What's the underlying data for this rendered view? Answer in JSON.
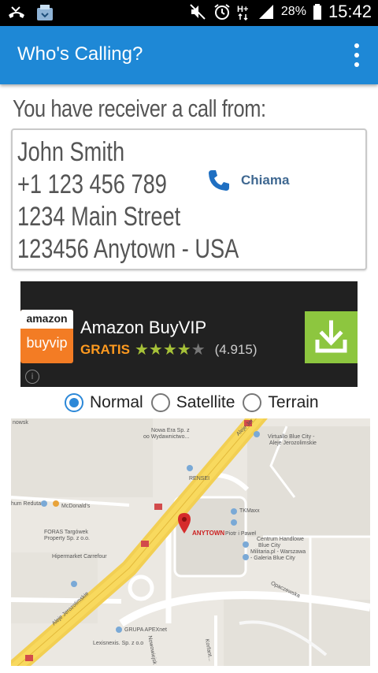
{
  "status_bar": {
    "battery_pct": "28%",
    "time": "15:42"
  },
  "app_bar": {
    "title": "Who's Calling?"
  },
  "heading": "You have receiver a call from:",
  "caller": {
    "lines": [
      "John Smith",
      "+1 123 456 789",
      "1234 Main Street",
      "123456 Anytown - USA"
    ],
    "call_label": "Chiama"
  },
  "ad": {
    "logo_top": "amazon",
    "logo_bottom": "buyvip",
    "name": "Amazon BuyVIP",
    "price": "GRATIS",
    "rating_stars": 4,
    "rating_count": "(4.915)"
  },
  "map_type": {
    "options": [
      "Normal",
      "Satellite",
      "Terrain"
    ],
    "selected": "Normal"
  },
  "map": {
    "labels": {
      "nowsk": "nowsk",
      "nowa_era": "Nowa Era Sp. z",
      "nowa_era2": "oo Wydawnictwo...",
      "aleje_jer_top": "Aleje Jer",
      "virtuallo": "Virtuallo Blue City -",
      "virtuallo2": "Aleje Jerozolimskie",
      "rensei": "RENSEI",
      "reduta": "hum Reduta",
      "mcdonalds": "McDonald's",
      "tkmaxx": "TKMaxx",
      "anytown": "ANYTOWN",
      "piotr": "Piotr i Paweł",
      "centrum": "Centrum Handlowe",
      "centrum2": "Blue City",
      "foras": "FORAS Targówek",
      "foras2": "Property Sp. z o.o.",
      "militaria": "Militaria.pl - Warszawa",
      "militaria2": "- Galeria Blue City",
      "carrefour": "Hipermarket Carrefour",
      "aleje_jer": "Aleje Jerozolimskie",
      "opaczewska": "Opaczewska",
      "grupa": "GRUPA APEXnet",
      "lexisnexis": "Lexisnexis. Sp. z o.o",
      "korfantego": "Korfant...",
      "nowowiejska": "Nowowiejsk"
    }
  }
}
